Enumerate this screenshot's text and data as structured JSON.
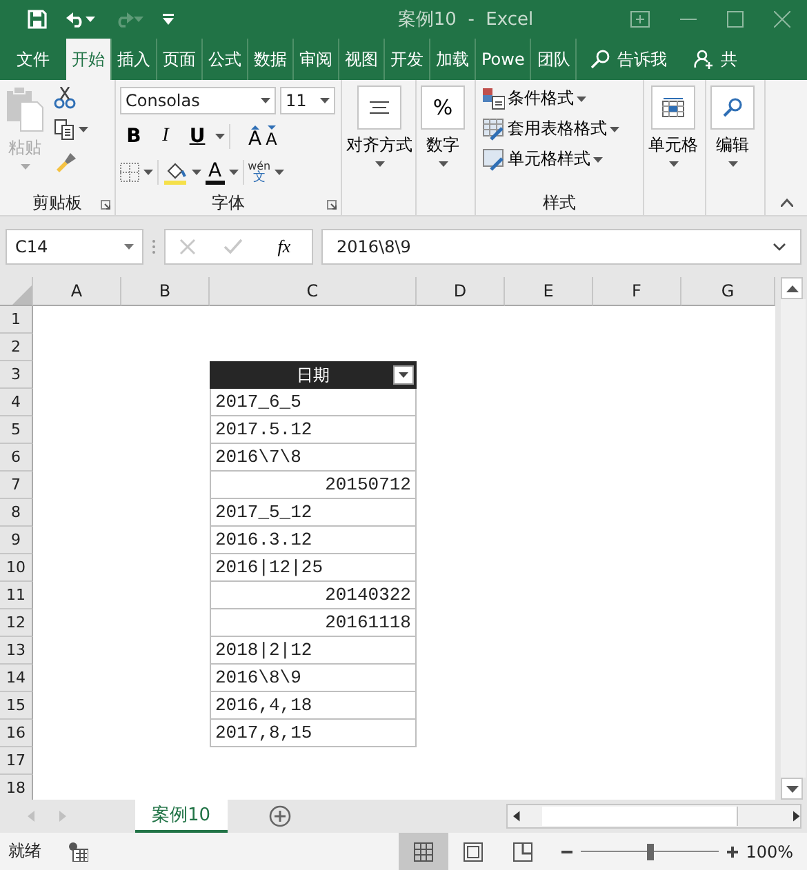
{
  "title_bar": {
    "title": "案例10  -  Excel",
    "quick_access": [
      {
        "kind": "save",
        "disabled": false
      },
      {
        "kind": "undo",
        "disabled": false
      },
      {
        "kind": "redo",
        "disabled": true
      },
      {
        "kind": "customize",
        "disabled": false
      }
    ]
  },
  "menu_tabs": [
    {
      "label": "文件",
      "selected": false
    },
    {
      "label": "开始",
      "selected": true
    },
    {
      "label": "插入",
      "selected": false
    },
    {
      "label": "页面",
      "selected": false
    },
    {
      "label": "公式",
      "selected": false
    },
    {
      "label": "数据",
      "selected": false
    },
    {
      "label": "审阅",
      "selected": false
    },
    {
      "label": "视图",
      "selected": false
    },
    {
      "label": "开发",
      "selected": false
    },
    {
      "label": "加载",
      "selected": false
    },
    {
      "label": "Powe",
      "selected": false
    },
    {
      "label": "团队",
      "selected": false
    }
  ],
  "tell_me": "告诉我",
  "share": "共",
  "ribbon": {
    "clipboard": {
      "label": "剪贴板",
      "paste": {
        "label": "粘贴",
        "disabled": true
      }
    },
    "font": {
      "label": "字体",
      "font_name": "Consolas",
      "font_size": "11",
      "bold": "B",
      "italic": "I",
      "underline": "U",
      "grow": "A",
      "shrink": "A",
      "font_color": "A",
      "phonetic_top": "wén",
      "phonetic_bottom": "文"
    },
    "alignment": {
      "label": "对齐方式"
    },
    "number": {
      "label": "数字",
      "glyph": "%"
    },
    "styles": {
      "label": "样式",
      "items": [
        {
          "kind": "conditional",
          "label": "条件格式"
        },
        {
          "kind": "table",
          "label": "套用表格格式"
        },
        {
          "kind": "cell",
          "label": "单元格样式"
        }
      ]
    },
    "cells": {
      "label": "单元格"
    },
    "editing": {
      "label": "编辑"
    }
  },
  "formula_bar": {
    "name_box": "C14",
    "function_label": "fx",
    "formula": "2016\\8\\9"
  },
  "sheet": {
    "columns": [
      "A",
      "B",
      "C",
      "D",
      "E",
      "F",
      "G"
    ],
    "rows": [
      "1",
      "2",
      "3",
      "4",
      "5",
      "6",
      "7",
      "8",
      "9",
      "10",
      "11",
      "12",
      "13",
      "14",
      "15",
      "16",
      "17",
      "18"
    ],
    "table": {
      "header": "日期",
      "cells": [
        {
          "value": "2017_6_5",
          "kind": "text"
        },
        {
          "value": "2017.5.12",
          "kind": "text"
        },
        {
          "value": "2016\\7\\8",
          "kind": "text"
        },
        {
          "value": "20150712",
          "kind": "number"
        },
        {
          "value": "2017_5_12",
          "kind": "text"
        },
        {
          "value": "2016.3.12",
          "kind": "text"
        },
        {
          "value": "2016|12|25",
          "kind": "text"
        },
        {
          "value": "20140322",
          "kind": "number"
        },
        {
          "value": "20161118",
          "kind": "number"
        },
        {
          "value": "2018|2|12",
          "kind": "text"
        },
        {
          "value": "2016\\8\\9",
          "kind": "text"
        },
        {
          "value": "2016,4,18",
          "kind": "text"
        },
        {
          "value": "2017,8,15",
          "kind": "text"
        }
      ]
    }
  },
  "sheet_tabs": [
    {
      "label": "案例10",
      "selected": true
    }
  ],
  "status_bar": {
    "status": "就绪",
    "views": [
      {
        "kind": "normal",
        "selected": true
      },
      {
        "kind": "page_layout",
        "selected": false
      },
      {
        "kind": "page_break",
        "selected": false
      }
    ],
    "zoom": {
      "level": 0.5,
      "reading": "100%"
    }
  }
}
